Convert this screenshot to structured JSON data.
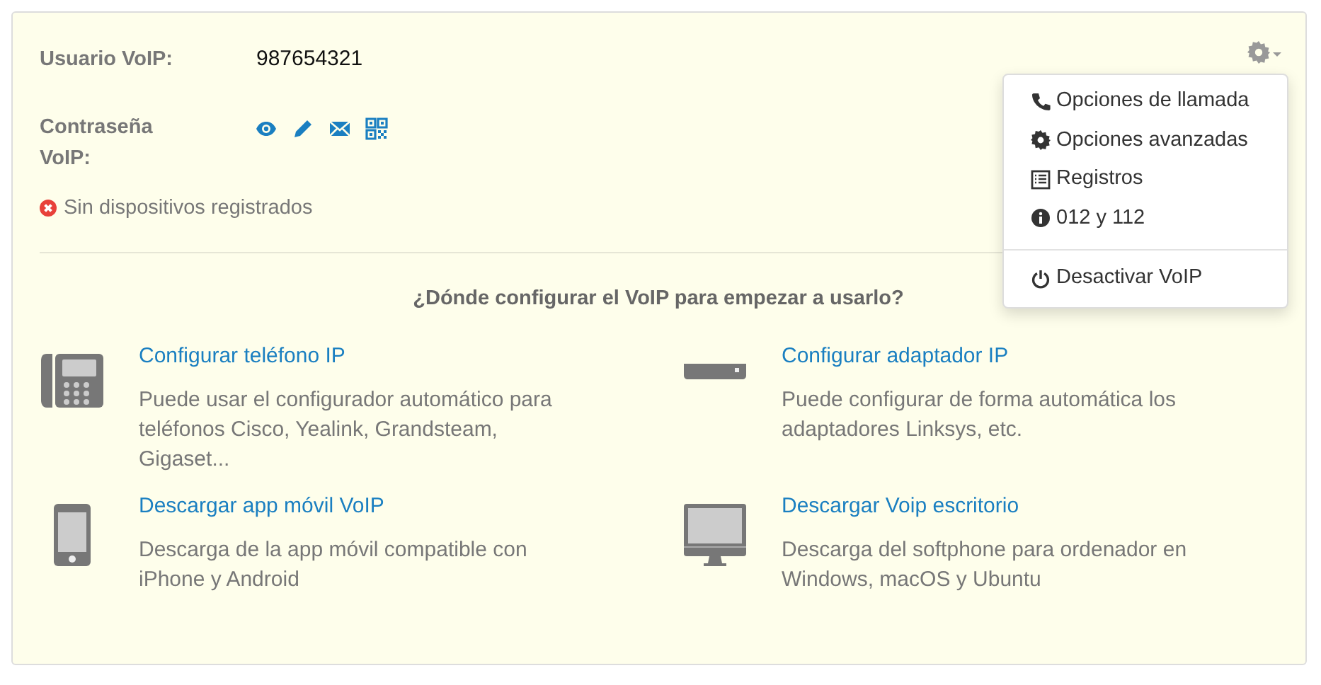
{
  "fields": [
    {
      "label": "Usuario VoIP:",
      "value": "987654321"
    },
    {
      "label": "Contraseña VoIP:",
      "actions": [
        {
          "kind": "eye"
        },
        {
          "kind": "pencil"
        },
        {
          "kind": "envelope"
        },
        {
          "kind": "qr"
        }
      ]
    }
  ],
  "status": {
    "kind": "error",
    "text": "Sin dispositivos registrados"
  },
  "heading": "¿Dónde configurar el VoIP para empezar a usarlo?",
  "options": [
    {
      "kind": "desk-phone",
      "title": "Configurar teléfono IP",
      "description": "Puede usar el configurador automático para teléfonos Cisco, Yealink, Grandsteam, Gigaset..."
    },
    {
      "kind": "adapter",
      "title": "Configurar adaptador IP",
      "description": "Puede configurar de forma automática los adaptadores Linksys, etc."
    },
    {
      "kind": "mobile",
      "title": "Descargar app móvil VoIP",
      "description": "Descarga de la app móvil compatible con iPhone y Android"
    },
    {
      "kind": "monitor",
      "title": "Descargar Voip escritorio",
      "description": "Descarga del softphone para ordenador en Windows, macOS y Ubuntu"
    }
  ],
  "menu": {
    "open": true,
    "groups": [
      [
        {
          "kind": "phone",
          "label": "Opciones de llamada"
        },
        {
          "kind": "gear",
          "label": "Opciones avanzadas"
        },
        {
          "kind": "list",
          "label": "Registros"
        },
        {
          "kind": "info",
          "label": "012 y 112"
        }
      ],
      [
        {
          "kind": "power",
          "label": "Desactivar VoIP"
        }
      ]
    ]
  }
}
